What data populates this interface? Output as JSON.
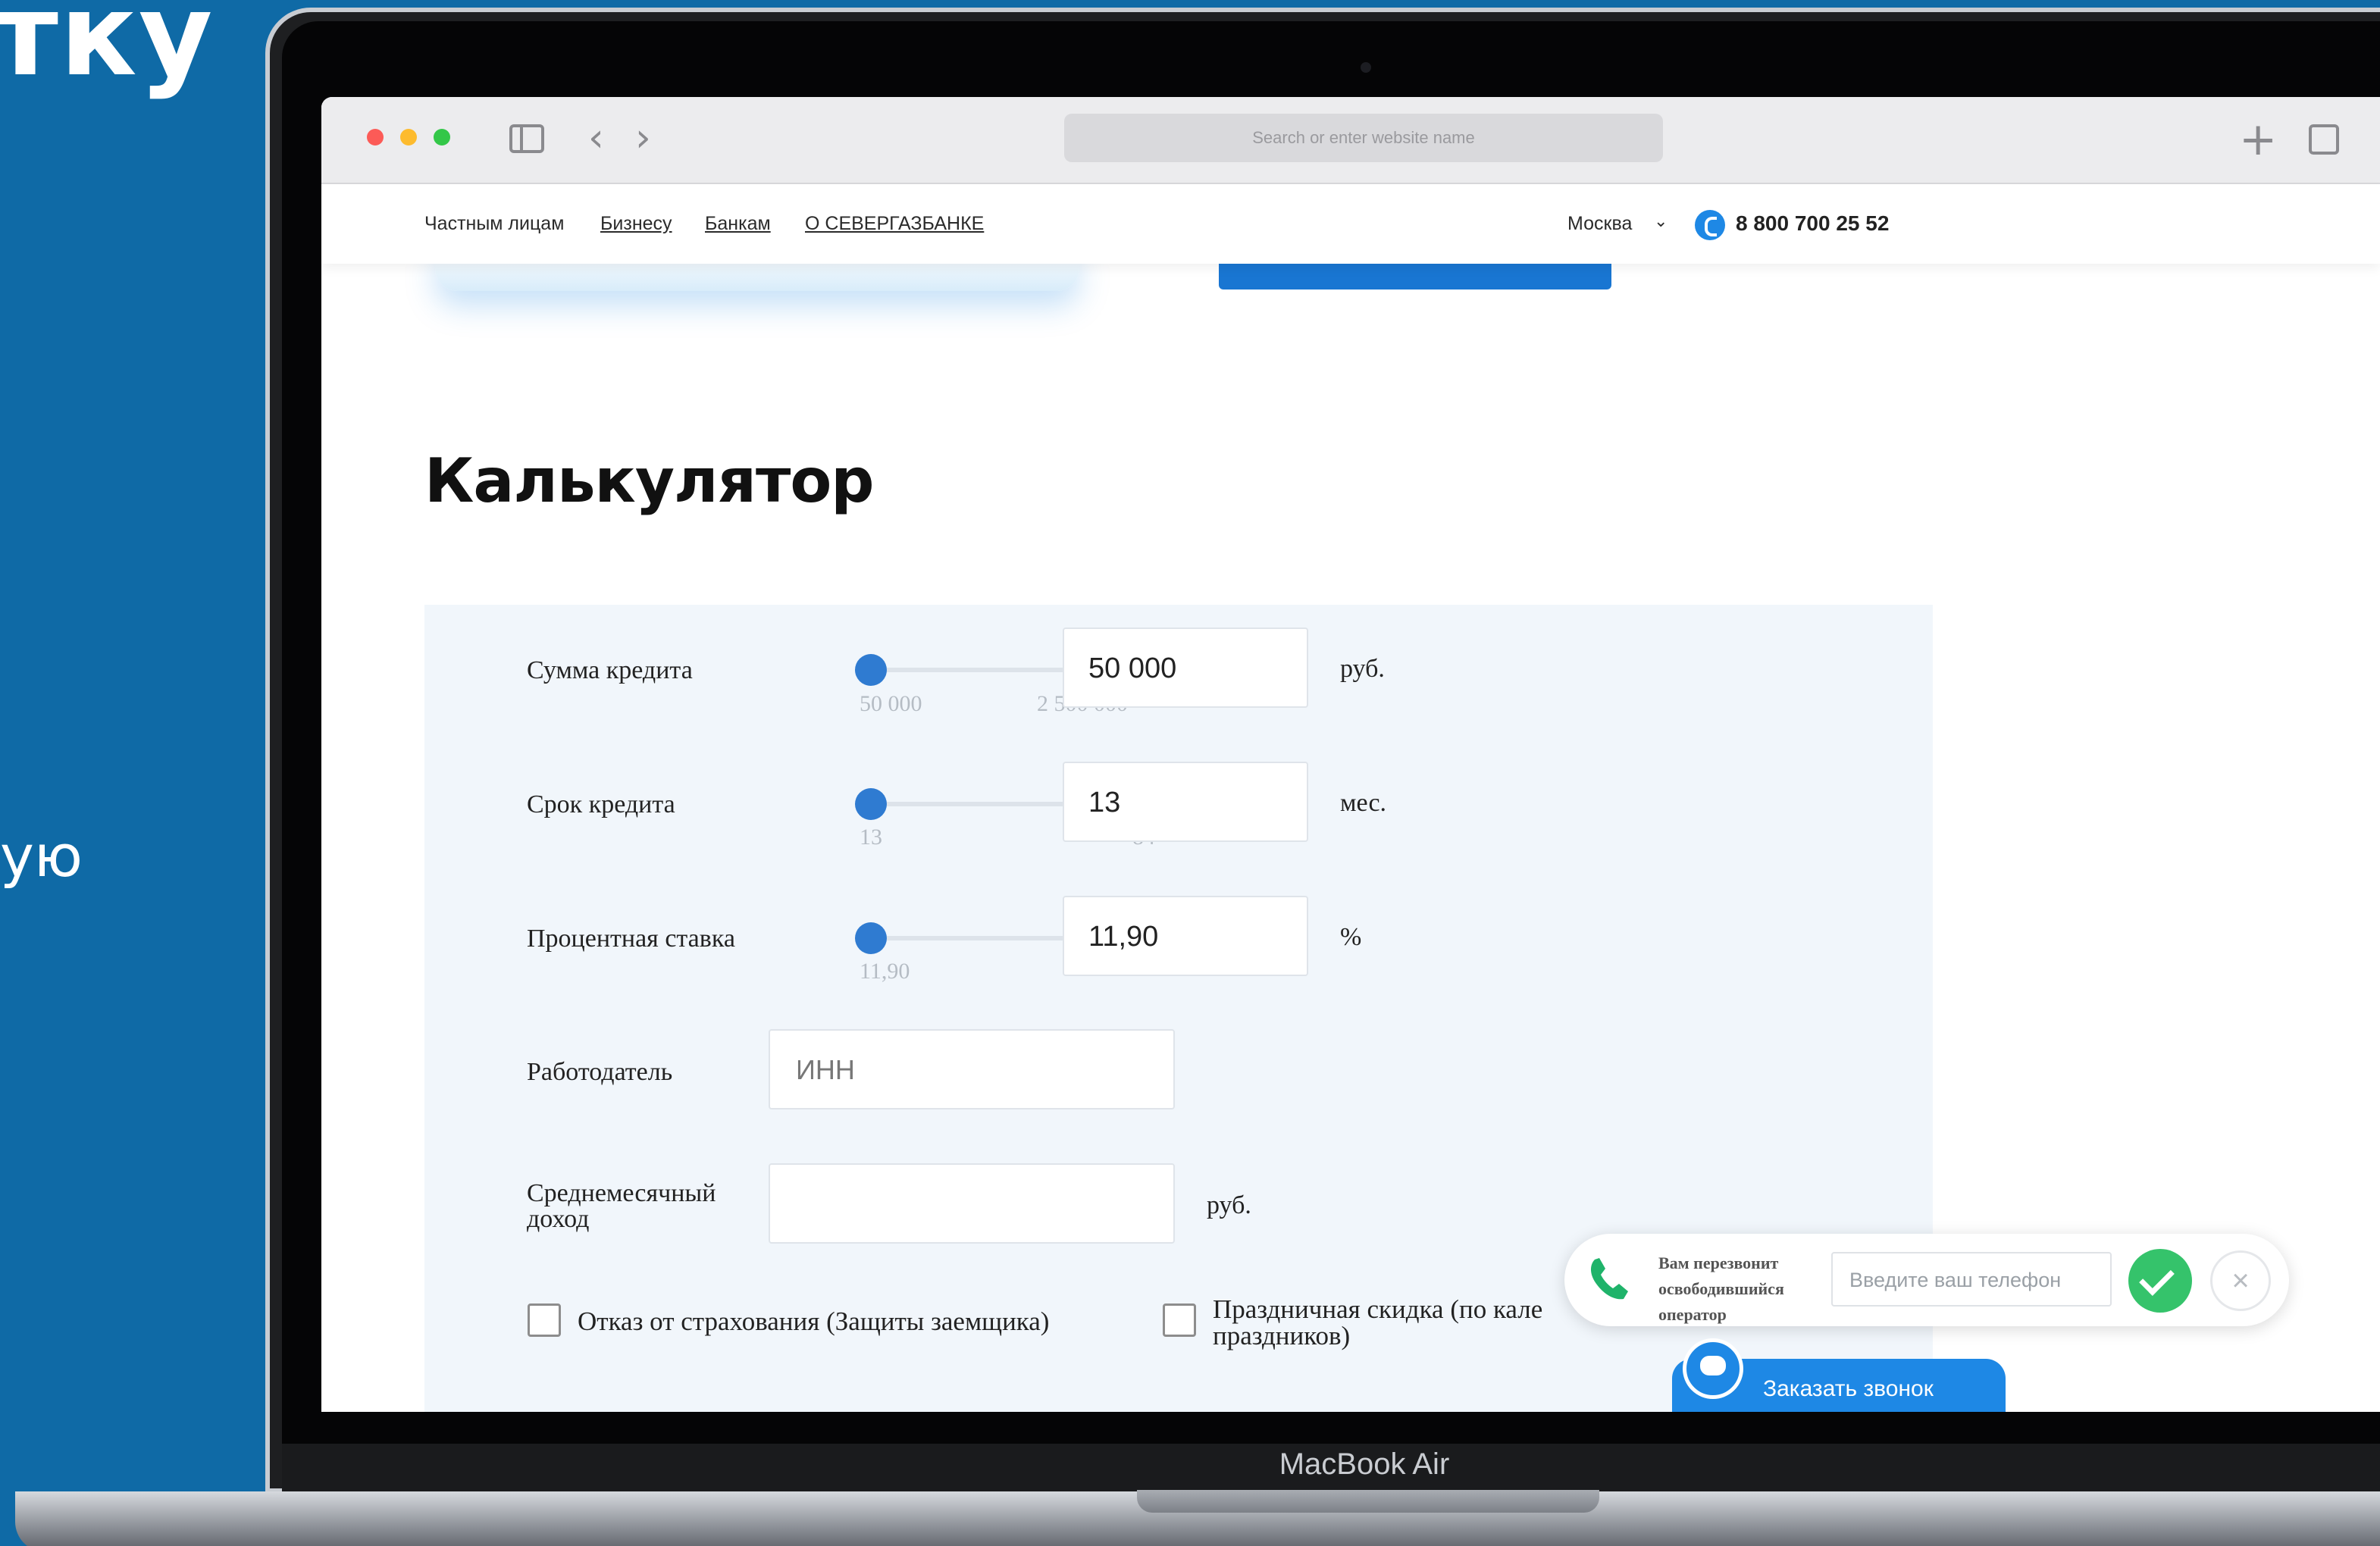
{
  "promo": {
    "top_fragment": "тку",
    "mid_fragment": "ую"
  },
  "device": {
    "brand_label": "MacBook Air"
  },
  "browser": {
    "address_placeholder": "Search or enter website name",
    "back_glyph": "‹",
    "forward_glyph": "›",
    "new_tab_glyph": "+"
  },
  "site_nav": {
    "links": [
      "Частным лицам",
      "Бизнесу",
      "Банкам",
      "О СЕВЕРГАЗБАНКЕ"
    ],
    "city": "Москва",
    "phone": "8 800 700 25 52"
  },
  "page": {
    "title": "Калькулятор"
  },
  "calculator": {
    "rows": [
      {
        "label": "Сумма кредита",
        "min": "50 000",
        "max": "2 500 000",
        "value": "50 000",
        "unit": "руб.",
        "level": 0
      },
      {
        "label": "Срок кредита",
        "min": "13",
        "max": "84",
        "value": "13",
        "unit": "мес.",
        "level": 0
      },
      {
        "label": "Процентная ставка",
        "min": "11,90",
        "max": "",
        "value": "11,90",
        "unit": "%",
        "level": 0
      }
    ],
    "employer": {
      "label": "Работодатель",
      "placeholder": "ИНН"
    },
    "income": {
      "label_line1": "Среднемесячный",
      "label_line2": "доход",
      "value": "",
      "unit": "руб."
    },
    "checkboxes": [
      {
        "label": "Отказ от страхования (Защиты заемщика)",
        "checked": false
      },
      {
        "label_line1": "Праздничная скидка (по кале",
        "label_line2": "праздников)",
        "checked": false
      }
    ]
  },
  "callback": {
    "text_line1": "Вам перезвонит",
    "text_line2": "освободившийся",
    "text_line3": "оператор",
    "phone_placeholder": "Введите ваш телефон",
    "close_glyph": "×",
    "order_button": "Заказать звонок"
  },
  "colors": {
    "background": "#0f6aa6",
    "accent": "#1e88e5",
    "slider_thumb": "#2f7bd1",
    "confirm": "#35c36b"
  }
}
